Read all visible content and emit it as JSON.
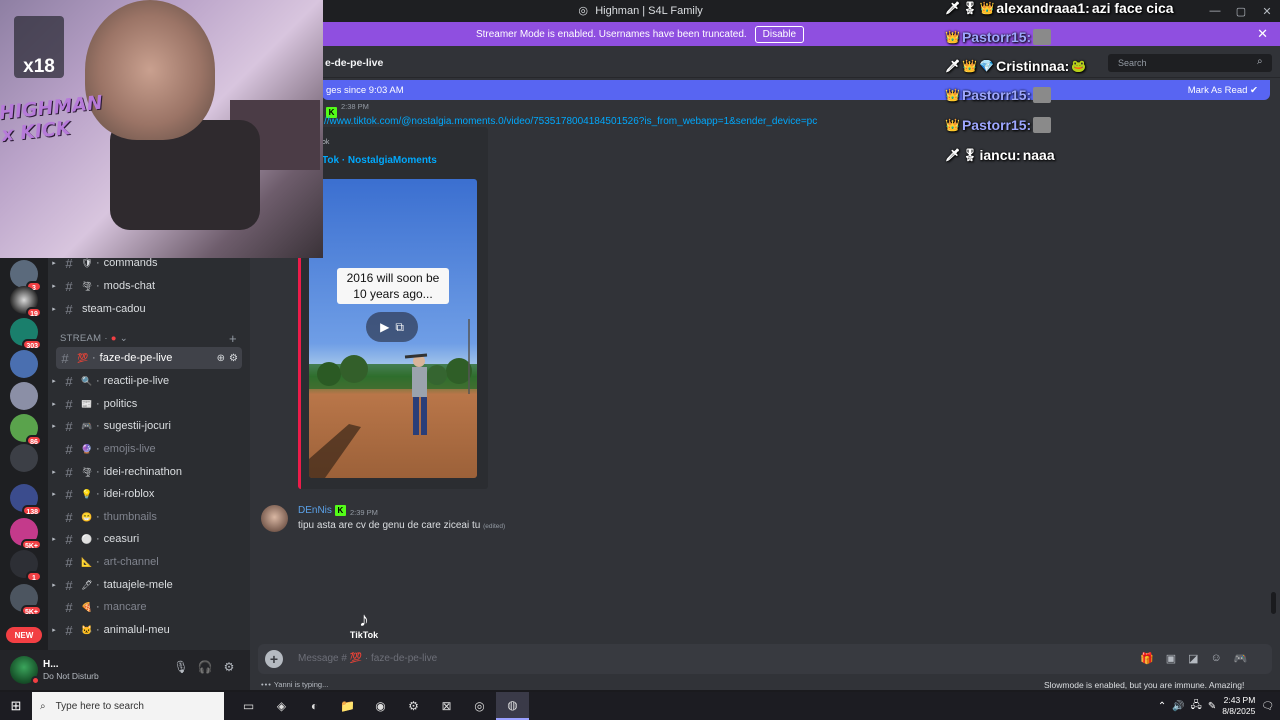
{
  "window": {
    "title": "Highman | S4L Family",
    "controls": [
      "—",
      "▢",
      "✕"
    ]
  },
  "banner": {
    "text": "Streamer Mode is enabled. Usernames have been truncated.",
    "disable_label": "Disable",
    "close": "✕"
  },
  "servers": {
    "badges": [
      "3",
      "19",
      "303",
      "86",
      "138",
      "5K+",
      "1",
      "5K+"
    ],
    "new_label": "NEW"
  },
  "sidebar": {
    "category": "STREAM ·",
    "channels": [
      {
        "name": "commands",
        "emoji": "🛡"
      },
      {
        "name": "mods-chat",
        "emoji": "🌪"
      },
      {
        "name": "steam-cadou",
        "emoji": ""
      },
      {
        "name": "faze-de-pe-live",
        "emoji": "💯"
      },
      {
        "name": "reactii-pe-live",
        "emoji": "🔍"
      },
      {
        "name": "politics",
        "emoji": "📰"
      },
      {
        "name": "sugestii-jocuri",
        "emoji": "🎮"
      },
      {
        "name": "emojis-live",
        "emoji": "🔮"
      },
      {
        "name": "idei-rechinathon",
        "emoji": "🌪"
      },
      {
        "name": "idei-roblox",
        "emoji": "💡"
      },
      {
        "name": "thumbnails",
        "emoji": "😁"
      },
      {
        "name": "ceasuri",
        "emoji": "⚪"
      },
      {
        "name": "art-channel",
        "emoji": "📐"
      },
      {
        "name": "tatuajele-mele",
        "emoji": "🖊"
      },
      {
        "name": "mancare",
        "emoji": "🍕"
      },
      {
        "name": "animalul-meu",
        "emoji": "🐱"
      }
    ]
  },
  "user": {
    "name": "H...",
    "status": "Do Not Disturb"
  },
  "chat": {
    "channel_title": "e-de-pe-live",
    "search_placeholder": "Search",
    "new_messages": "ges since 9:03 AM",
    "mark_as_read": "Mark As Read",
    "msg1_time": "2:38 PM",
    "msg1_link": "//www.tiktok.com/@nostalgia.moments.0/video/7535178004184501526?is_from_webapp=1&sender_device=pc",
    "embed_provider": "ok",
    "embed_title": "Tok · NostalgiaMoments",
    "video_caption": "2016 will soon be 10 years ago...",
    "msg2_author": "DEnNis",
    "msg2_time": "2:39 PM",
    "msg2_text": "tipu asta are cv de genu de care ziceai tu",
    "msg2_edited": "(edited)",
    "tiktok_watermark": "TikTok",
    "composer_placeholder": "Message # 💯 · faze-de-pe-live",
    "typing": "Yanni is typing...",
    "slowmode": "Slowmode is enabled, but you are immune. Amazing!"
  },
  "webcam": {
    "overlay_logo": "HIGHMAN x KICK",
    "counter": "x18"
  },
  "stream_chat": [
    {
      "user": "alexandraaa1:",
      "text": "azi face cica",
      "name_color": "#ffffff"
    },
    {
      "user": "Pastorr15:",
      "text": "",
      "name_color": "#9ea7ff"
    },
    {
      "user": "Cristinnaa:",
      "text": "",
      "name_color": "#ffffff"
    },
    {
      "user": "Pastorr15:",
      "text": "",
      "name_color": "#9ea7ff"
    },
    {
      "user": "Pastorr15:",
      "text": "",
      "name_color": "#9ea7ff"
    },
    {
      "user": "iancu:",
      "text": "naaa",
      "name_color": "#ffffff"
    }
  ],
  "taskbar": {
    "search_placeholder": "Type here to search",
    "time": "2:43 PM",
    "date": "8/8/2025"
  },
  "colors": {
    "accent": "#5865f2",
    "streamer_banner": "#8f4fe0",
    "kick_green": "#53fc18",
    "notification_red": "#f23f43",
    "link_blue": "#00a8fc"
  }
}
